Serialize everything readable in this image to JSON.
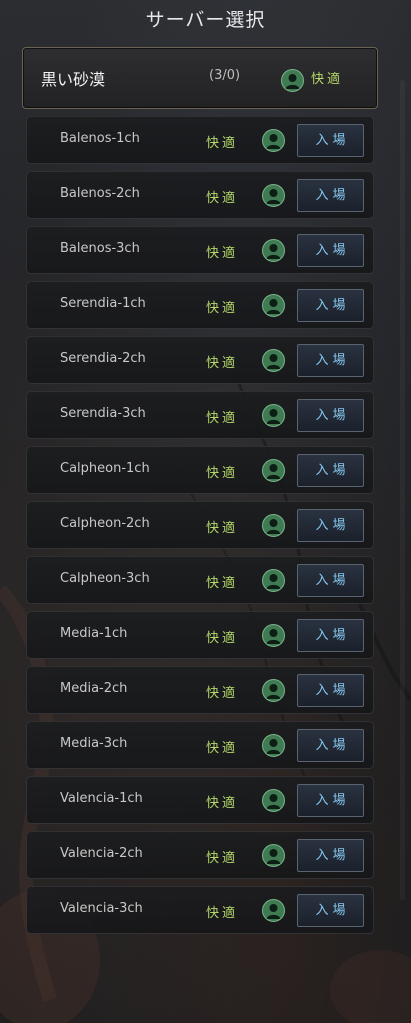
{
  "title": "サーバー選択",
  "server": {
    "name": "黒い砂漠",
    "count": "(3/0)",
    "status": "快適",
    "status_icon": "user-circle-icon"
  },
  "colors": {
    "status_text": "#b6d86a",
    "button_text": "#86c8f0",
    "icon_bg": "#3f7a52"
  },
  "channels": [
    {
      "name": "Balenos-1ch",
      "status": "快適",
      "button": "入場"
    },
    {
      "name": "Balenos-2ch",
      "status": "快適",
      "button": "入場"
    },
    {
      "name": "Balenos-3ch",
      "status": "快適",
      "button": "入場"
    },
    {
      "name": "Serendia-1ch",
      "status": "快適",
      "button": "入場"
    },
    {
      "name": "Serendia-2ch",
      "status": "快適",
      "button": "入場"
    },
    {
      "name": "Serendia-3ch",
      "status": "快適",
      "button": "入場"
    },
    {
      "name": "Calpheon-1ch",
      "status": "快適",
      "button": "入場"
    },
    {
      "name": "Calpheon-2ch",
      "status": "快適",
      "button": "入場"
    },
    {
      "name": "Calpheon-3ch",
      "status": "快適",
      "button": "入場"
    },
    {
      "name": "Media-1ch",
      "status": "快適",
      "button": "入場"
    },
    {
      "name": "Media-2ch",
      "status": "快適",
      "button": "入場"
    },
    {
      "name": "Media-3ch",
      "status": "快適",
      "button": "入場"
    },
    {
      "name": "Valencia-1ch",
      "status": "快適",
      "button": "入場"
    },
    {
      "name": "Valencia-2ch",
      "status": "快適",
      "button": "入場"
    },
    {
      "name": "Valencia-3ch",
      "status": "快適",
      "button": "入場"
    }
  ]
}
